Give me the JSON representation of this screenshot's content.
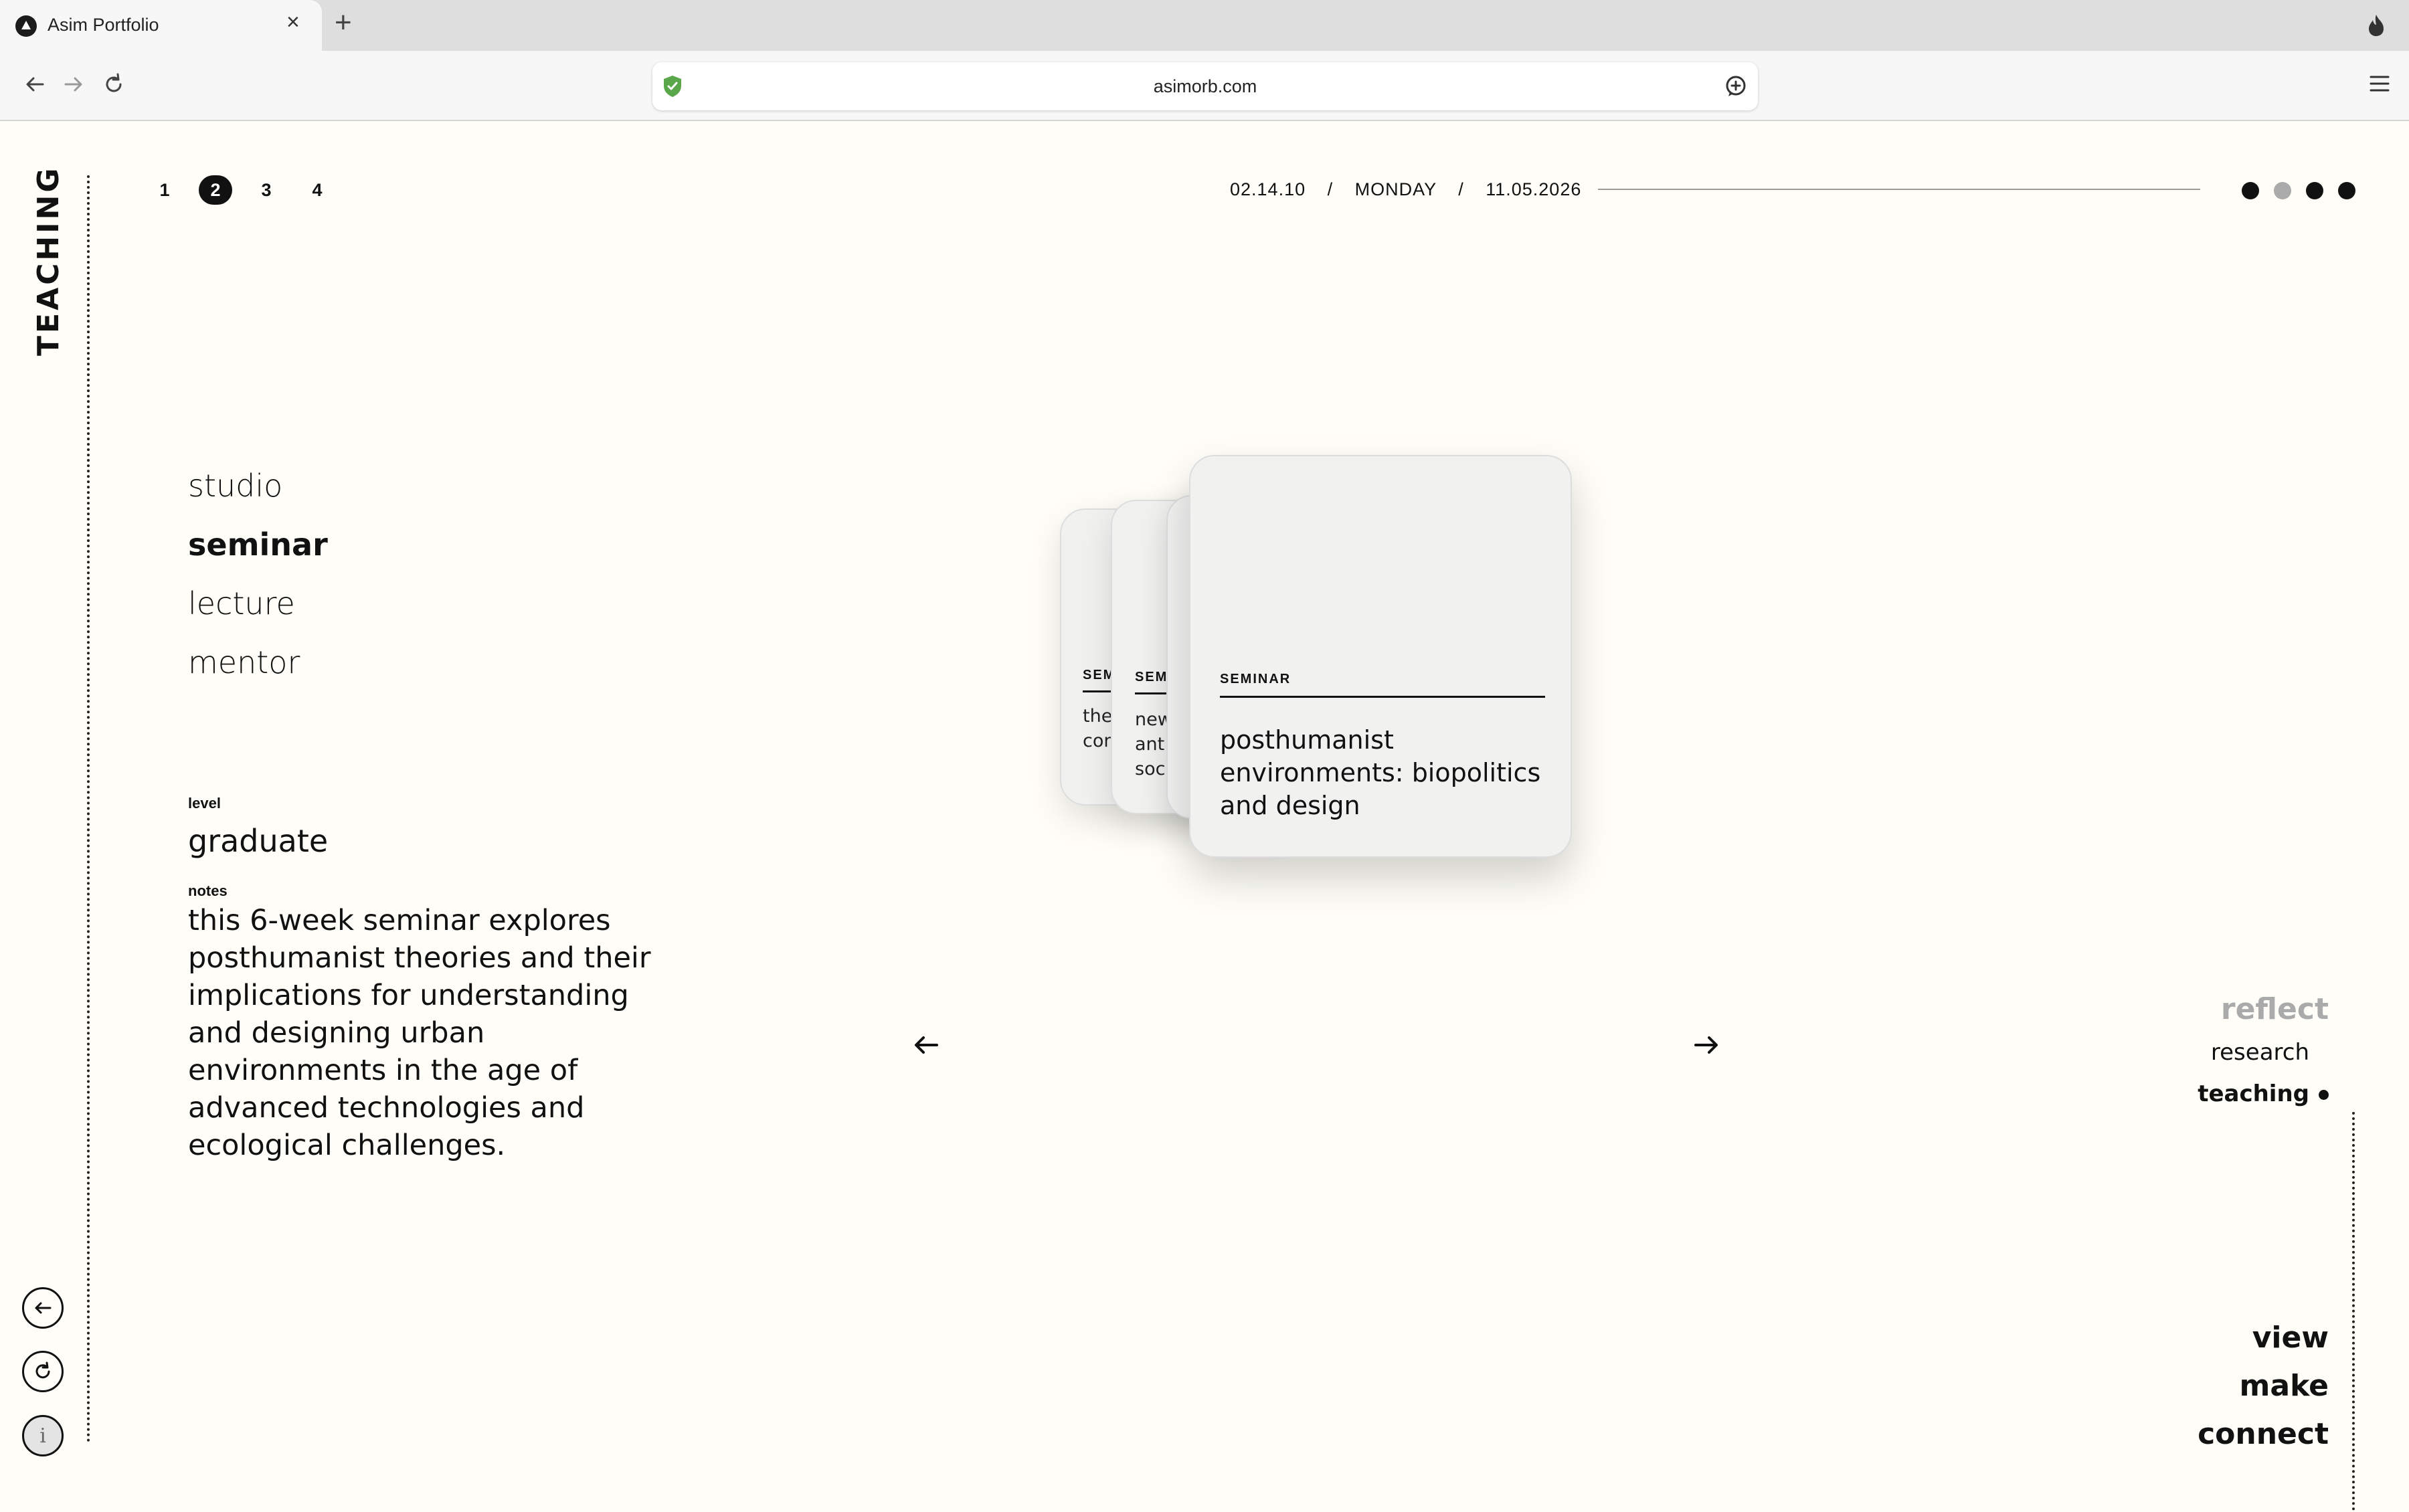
{
  "browser": {
    "tab_title": "Asim Portfolio",
    "url": "asimorb.com"
  },
  "page": {
    "section_title": "TEACHING",
    "pages": [
      "1",
      "2",
      "3",
      "4"
    ],
    "active_page": "2",
    "time": "02.14.10",
    "separator": "/",
    "weekday": "MONDAY",
    "date": "11.05.2026",
    "indicator_dots": [
      "filled",
      "grey",
      "filled",
      "filled"
    ],
    "categories": [
      "studio",
      "seminar",
      "lecture",
      "mentor"
    ],
    "active_category": "seminar",
    "level_label": "level",
    "level_value": "graduate",
    "notes_label": "notes",
    "notes_text": "this 6-week seminar explores posthumanist theories and their implications for understanding and designing urban environments in the age of advanced technologies and ecological challenges.",
    "cards": {
      "back1": {
        "label": "SEMI",
        "peek": [
          "the",
          "con"
        ]
      },
      "back2": {
        "label": "SEMI",
        "peek": [
          "new",
          "ant",
          "soc"
        ]
      },
      "front": {
        "label": "SEMINAR",
        "title": "posthumanist environments: biopolitics and design"
      }
    },
    "side_nav": {
      "heading": "reflect",
      "items": [
        "research",
        "teaching"
      ],
      "active": "teaching"
    },
    "bottom_nav": [
      "view",
      "make",
      "connect"
    ],
    "info_glyph": "i",
    "colors": {
      "background": "#fefdf7",
      "text": "#111111",
      "muted": "#aaaaaa",
      "card": "#f1f1f0"
    }
  }
}
